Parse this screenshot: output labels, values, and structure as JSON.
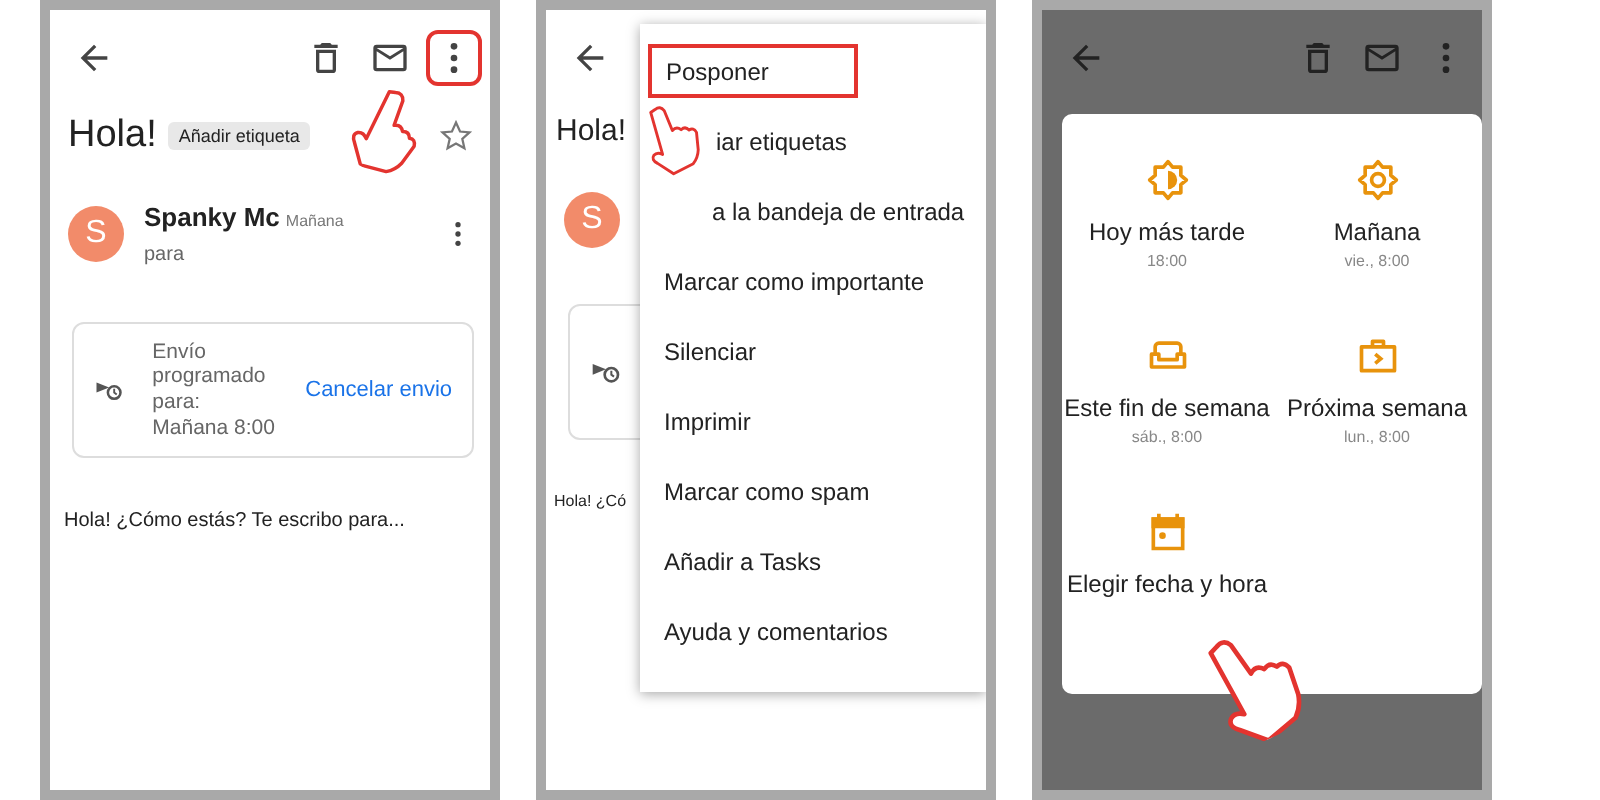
{
  "email_screen": {
    "subject": "Hola!",
    "label_chip": "Añadir etiqueta",
    "starred": false,
    "highlight_more": true,
    "sender": {
      "initial": "S",
      "name": "Spanky Mc",
      "time": "Mañana",
      "recipient": "para"
    },
    "scheduled": {
      "text": "Envío programado para: Mañana 8:00",
      "action": "Cancelar envio"
    },
    "body": "Hola! ¿Cómo estás? Te escribo para..."
  },
  "menu_screen": {
    "subject": "Hola!",
    "initial": "S",
    "body_fragment": "Hola! ¿Có",
    "items": [
      {
        "label": "Posponer",
        "highlighted": true
      },
      {
        "label": "iar etiquetas",
        "highlighted": false
      },
      {
        "label": "a la bandeja de entrada",
        "highlighted": false
      },
      {
        "label": "Marcar como importante",
        "highlighted": false
      },
      {
        "label": "Silenciar",
        "highlighted": false
      },
      {
        "label": "Imprimir",
        "highlighted": false
      },
      {
        "label": "Marcar como spam",
        "highlighted": false
      },
      {
        "label": "Añadir a Tasks",
        "highlighted": false
      },
      {
        "label": "Ayuda y comentarios",
        "highlighted": false
      }
    ]
  },
  "snooze_screen": {
    "options": [
      {
        "kind": "later",
        "label": "Hoy más tarde",
        "time": "18:00"
      },
      {
        "kind": "tomorrow",
        "label": "Mañana",
        "time": "vie., 8:00"
      },
      {
        "kind": "weekend",
        "label": "Este fin de semana",
        "time": "sáb., 8:00"
      },
      {
        "kind": "next_week",
        "label": "Próxima semana",
        "time": "lun., 8:00"
      },
      {
        "kind": "pick",
        "label": "Elegir fecha y hora"
      }
    ]
  }
}
